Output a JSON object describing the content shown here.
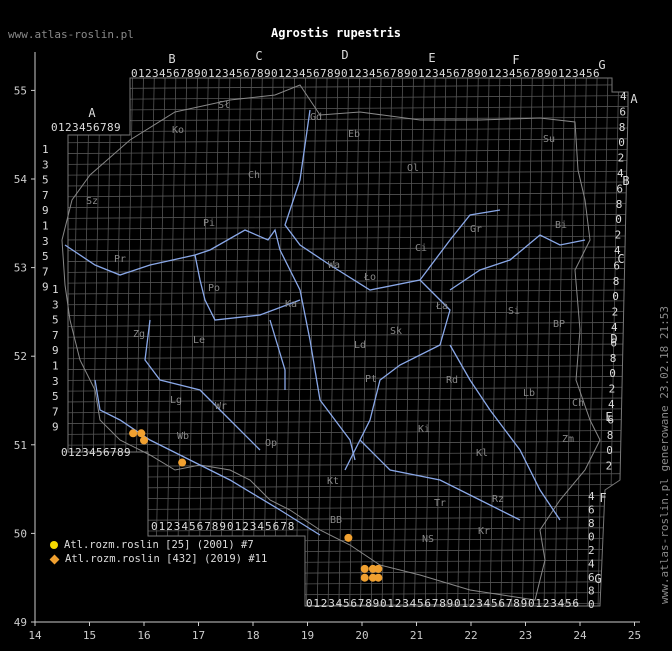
{
  "title": "Agrostis rupestris",
  "site_label": "www.atlas-roslin.pl",
  "generated_label": "www.atlas-roslin.pl generowane 23.02.18 21:53",
  "axis": {
    "x_ticks": [
      "14",
      "15",
      "16",
      "17",
      "18",
      "19",
      "20",
      "21",
      "22",
      "23",
      "24",
      "25"
    ],
    "y_ticks": [
      "49",
      "50",
      "51",
      "52",
      "53",
      "54",
      "55"
    ]
  },
  "grid_columns": [
    "A",
    "B",
    "C",
    "D",
    "E",
    "F",
    "G"
  ],
  "grid_rows": [
    "A",
    "B",
    "C",
    "D",
    "E",
    "F",
    "G"
  ],
  "region_labels": [
    "Sł",
    "Ko",
    "Gd",
    "Eb",
    "Su",
    "Ch",
    "Ol",
    "Pi",
    "Bi",
    "Ci",
    "Gr",
    "Sz",
    "Wa",
    "Ło",
    "Ka",
    "Po",
    "Si",
    "BP",
    "Zg",
    "Le",
    "Ła",
    "Sk",
    "Ld",
    "Pt",
    "Rd",
    "Lb",
    "Ch",
    "Lg",
    "Wr",
    "Wb",
    "Op",
    "Kl",
    "Ki",
    "Zm",
    "Kt",
    "Tr",
    "Rz",
    "BB",
    "NS",
    "Kr",
    "Pr"
  ],
  "legend": [
    {
      "label": "Atl.rozm.roslin [25] (2001) #7",
      "color": "#f5d800",
      "shape": "circle"
    },
    {
      "label": "Atl.rozm.roslin [432] (2019) #11",
      "color": "#f0a030",
      "shape": "diamond"
    }
  ],
  "colors": {
    "grid": "#555555",
    "river": "#8aa8e8",
    "border": "#888888",
    "axis": "#cccccc"
  },
  "points": [
    {
      "lon": 15.8,
      "lat": 51.13,
      "series": 1
    },
    {
      "lon": 15.95,
      "lat": 51.13,
      "series": 1
    },
    {
      "lon": 16.0,
      "lat": 51.05,
      "series": 1
    },
    {
      "lon": 16.7,
      "lat": 50.8,
      "series": 1
    },
    {
      "lon": 19.75,
      "lat": 49.95,
      "series": 1
    },
    {
      "lon": 20.05,
      "lat": 49.6,
      "series": 1
    },
    {
      "lon": 20.2,
      "lat": 49.6,
      "series": 1
    },
    {
      "lon": 20.3,
      "lat": 49.6,
      "series": 1
    },
    {
      "lon": 20.05,
      "lat": 49.5,
      "series": 1
    },
    {
      "lon": 20.2,
      "lat": 49.5,
      "series": 1
    },
    {
      "lon": 20.3,
      "lat": 49.5,
      "series": 1
    }
  ]
}
